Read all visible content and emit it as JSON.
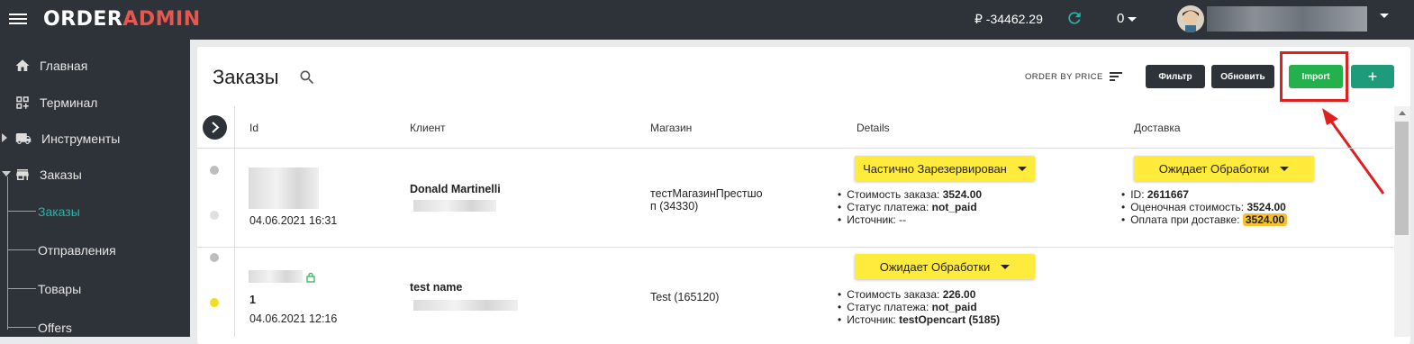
{
  "header": {
    "logo_part1": "ORDER",
    "logo_part2": "ADMIN",
    "balance": "₽ -34462.29",
    "counter": "0"
  },
  "sidebar": {
    "items": [
      {
        "label": "Главная"
      },
      {
        "label": "Терминал"
      },
      {
        "label": "Инструменты"
      },
      {
        "label": "Заказы"
      }
    ],
    "subitems": [
      {
        "label": "Заказы"
      },
      {
        "label": "Отправления"
      },
      {
        "label": "Товары"
      },
      {
        "label": "Offers"
      }
    ]
  },
  "page": {
    "title": "Заказы",
    "order_by": "ORDER BY PRICE",
    "buttons": {
      "filter": "Фильтр",
      "refresh": "Обновить",
      "import": "Import",
      "add": "+"
    }
  },
  "table": {
    "headers": [
      "Id",
      "Клиент",
      "Магазин",
      "Details",
      "Доставка"
    ],
    "rows": [
      {
        "id": "",
        "date": "04.06.2021 16:31",
        "client": "Donald Martinelli",
        "shop_line1": "тестМагазинПрестašо",
        "shop_line2": "п (34330)",
        "status": "Частично Зарезервирован",
        "details": [
          {
            "label": "Стоимость заказа: ",
            "value": "3524.00"
          },
          {
            "label": "Статус платежа: ",
            "value": "not_paid"
          },
          {
            "label": "Источник: --",
            "value": ""
          }
        ],
        "delivery_status": "Ожидает Обработки",
        "delivery": [
          {
            "label": "ID: ",
            "value": "2611667"
          },
          {
            "label": "Оценочная стоимость: ",
            "value": "3524.00"
          },
          {
            "label": "Оплата при доставке: ",
            "value": "3524.00"
          }
        ]
      },
      {
        "id": "1",
        "date": "04.06.2021 12:16",
        "client": "test name",
        "shop_line1": "Test (165120)",
        "status": "Ожидает Обработки",
        "details": [
          {
            "label": "Стоимость заказа: ",
            "value": "226.00"
          },
          {
            "label": "Статус платежа: ",
            "value": "not_paid"
          },
          {
            "label": "Источник: ",
            "value": "testOpencart (5185)"
          }
        ]
      }
    ]
  },
  "colors": {
    "topbar": "#2d3338",
    "accent_green": "#22b14c",
    "accent_teal": "#1e9b7b",
    "status_yellow": "#ffeb3b",
    "highlight_red": "#e02020",
    "active_link": "#2ab3a6"
  }
}
